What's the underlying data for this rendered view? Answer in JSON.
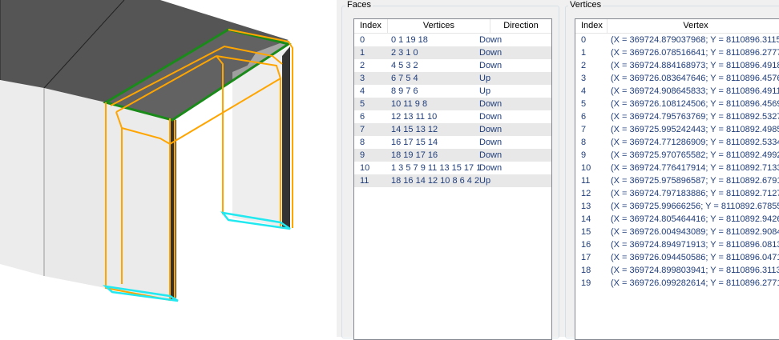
{
  "faces": {
    "group_label": "Faces",
    "columns": [
      "Index",
      "Vertices",
      "Direction"
    ],
    "rows": [
      {
        "index": "0",
        "vertices": "0 1 19 18",
        "direction": "Down"
      },
      {
        "index": "1",
        "vertices": "2 3 1 0",
        "direction": "Down"
      },
      {
        "index": "2",
        "vertices": "4 5 3 2",
        "direction": "Down"
      },
      {
        "index": "3",
        "vertices": "6 7 5 4",
        "direction": "Up"
      },
      {
        "index": "4",
        "vertices": "8 9 7 6",
        "direction": "Up"
      },
      {
        "index": "5",
        "vertices": "10 11 9 8",
        "direction": "Down"
      },
      {
        "index": "6",
        "vertices": "12 13 11 10",
        "direction": "Down"
      },
      {
        "index": "7",
        "vertices": "14 15 13 12",
        "direction": "Down"
      },
      {
        "index": "8",
        "vertices": "16 17 15 14",
        "direction": "Down"
      },
      {
        "index": "9",
        "vertices": "18 19 17 16",
        "direction": "Down"
      },
      {
        "index": "10",
        "vertices": "1 3 5 7 9 11 13 15 17 1",
        "direction": "Down"
      },
      {
        "index": "11",
        "vertices": "18 16 14 12 10 8 6 4 2",
        "direction": "Up"
      }
    ]
  },
  "vertices": {
    "group_label": "Vertices",
    "columns": [
      "Index",
      "Vertex"
    ],
    "rows": [
      {
        "index": "0",
        "vertex": "(X = 369724.879037968; Y = 8110896.3115"
      },
      {
        "index": "1",
        "vertex": "(X = 369726.078516641; Y = 8110896.2777"
      },
      {
        "index": "2",
        "vertex": "(X = 369724.884168973; Y = 8110896.4918"
      },
      {
        "index": "3",
        "vertex": "(X = 369726.083647646; Y = 8110896.4576"
      },
      {
        "index": "4",
        "vertex": "(X = 369724.908645833; Y = 8110896.4911"
      },
      {
        "index": "5",
        "vertex": "(X = 369726.108124506; Y = 8110896.4569"
      },
      {
        "index": "6",
        "vertex": "(X = 369724.795763769; Y = 8110892.5327"
      },
      {
        "index": "7",
        "vertex": "(X = 369725.995242443; Y = 8110892.4985"
      },
      {
        "index": "8",
        "vertex": "(X = 369724.771286909; Y = 8110892.5334"
      },
      {
        "index": "9",
        "vertex": "(X = 369725.970765582; Y = 8110892.4992"
      },
      {
        "index": "10",
        "vertex": "(X = 369724.776417914; Y = 8110892.7133"
      },
      {
        "index": "11",
        "vertex": "(X = 369725.975896587; Y = 8110892.6791"
      },
      {
        "index": "12",
        "vertex": "(X = 369724.797183886; Y = 8110892.7127"
      },
      {
        "index": "13",
        "vertex": "(X = 369725.99666256; Y = 8110892.67855"
      },
      {
        "index": "14",
        "vertex": "(X = 369724.805464416; Y = 8110892.9426"
      },
      {
        "index": "15",
        "vertex": "(X = 369726.004943089; Y = 8110892.9084"
      },
      {
        "index": "16",
        "vertex": "(X = 369724.894971913; Y = 8110896.0813"
      },
      {
        "index": "17",
        "vertex": "(X = 369726.094450586; Y = 8110896.0471"
      },
      {
        "index": "18",
        "vertex": "(X = 369724.899803941; Y = 8110896.3113"
      },
      {
        "index": "19",
        "vertex": "(X = 369726.099282614; Y = 8110896.2771"
      }
    ]
  },
  "colors": {
    "roof_dark": "#555555",
    "wall_light": "#ececec",
    "edge_orange": "#ffa500",
    "edge_green": "#1a8a1a",
    "edge_cyan": "#22e8f0",
    "row_text": "#1f3d7a",
    "alt_row_bg": "#e8e8e8"
  }
}
